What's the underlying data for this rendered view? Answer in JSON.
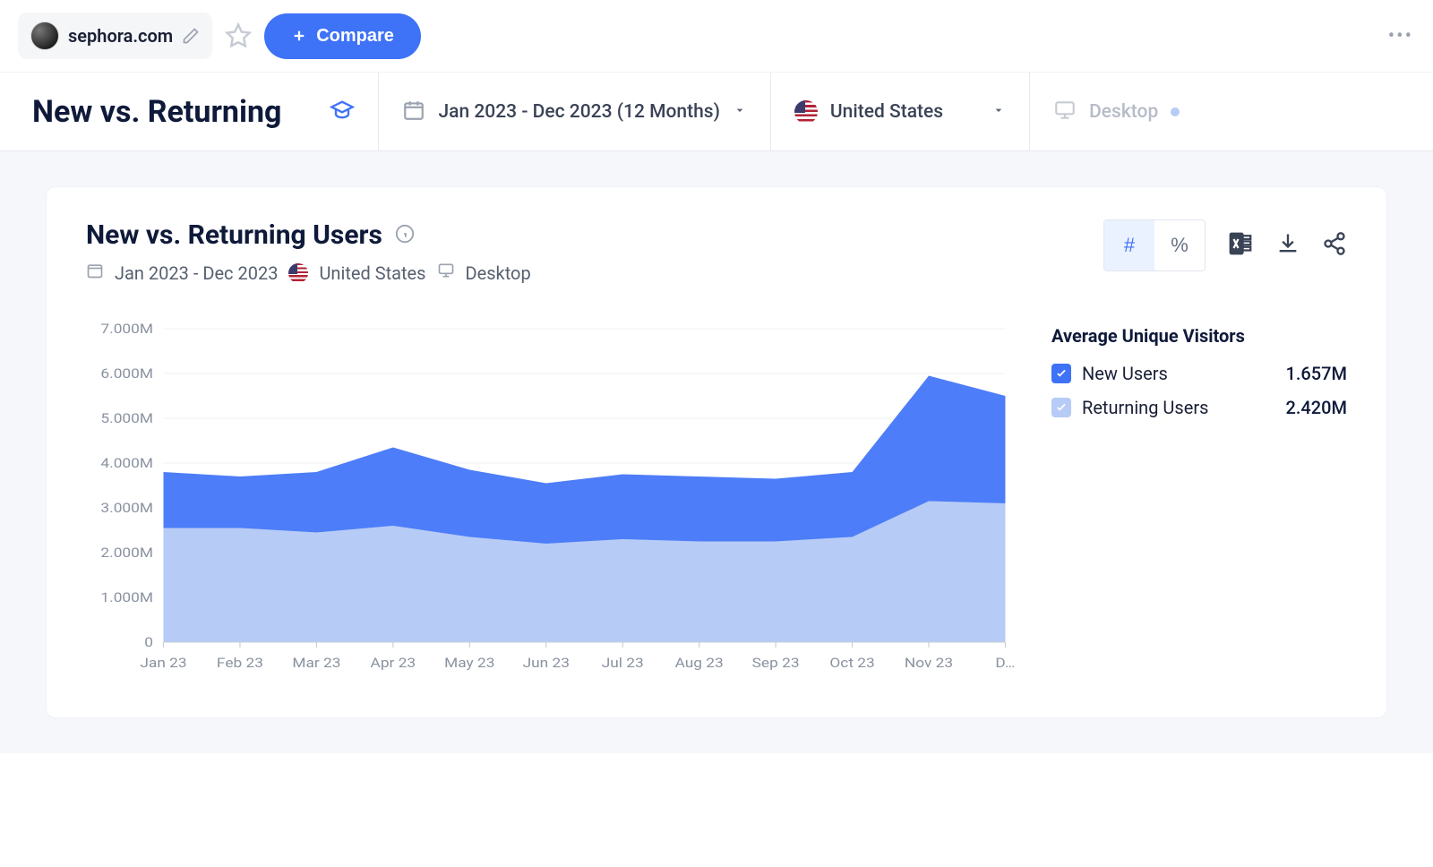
{
  "topbar": {
    "domain": "sephora.com",
    "compare_label": "Compare"
  },
  "filterbar": {
    "page_title": "New vs. Returning",
    "date_range": "Jan 2023 - Dec 2023 (12 Months)",
    "country": "United States",
    "device": "Desktop"
  },
  "card": {
    "title": "New vs. Returning Users",
    "sub_date": "Jan 2023 - Dec 2023",
    "sub_country": "United States",
    "sub_device": "Desktop",
    "toggle_hash": "#",
    "toggle_pct": "%"
  },
  "legend": {
    "title": "Average Unique Visitors",
    "series": [
      {
        "label": "New Users",
        "value": "1.657M",
        "color": "#3e72f7"
      },
      {
        "label": "Returning Users",
        "value": "2.420M",
        "color": "#b6cbf5"
      }
    ]
  },
  "chart_data": {
    "type": "area",
    "title": "New vs. Returning Users",
    "xlabel": "",
    "ylabel": "",
    "ylim": [
      0,
      7
    ],
    "y_unit": "M",
    "y_ticks": [
      "0",
      "1.000M",
      "2.000M",
      "3.000M",
      "4.000M",
      "5.000M",
      "6.000M",
      "7.000M"
    ],
    "categories": [
      "Jan 23",
      "Feb 23",
      "Mar 23",
      "Apr 23",
      "May 23",
      "Jun 23",
      "Jul 23",
      "Aug 23",
      "Sep 23",
      "Oct 23",
      "Nov 23",
      "D…"
    ],
    "series": [
      {
        "name": "Returning Users",
        "color": "#b6cbf5",
        "values": [
          2.55,
          2.55,
          2.45,
          2.6,
          2.35,
          2.2,
          2.3,
          2.25,
          2.25,
          2.35,
          3.15,
          3.1
        ]
      },
      {
        "name": "New Users",
        "color": "#3e72f7",
        "values": [
          1.25,
          1.15,
          1.35,
          1.75,
          1.5,
          1.35,
          1.45,
          1.45,
          1.4,
          1.45,
          2.8,
          2.4
        ]
      }
    ]
  }
}
